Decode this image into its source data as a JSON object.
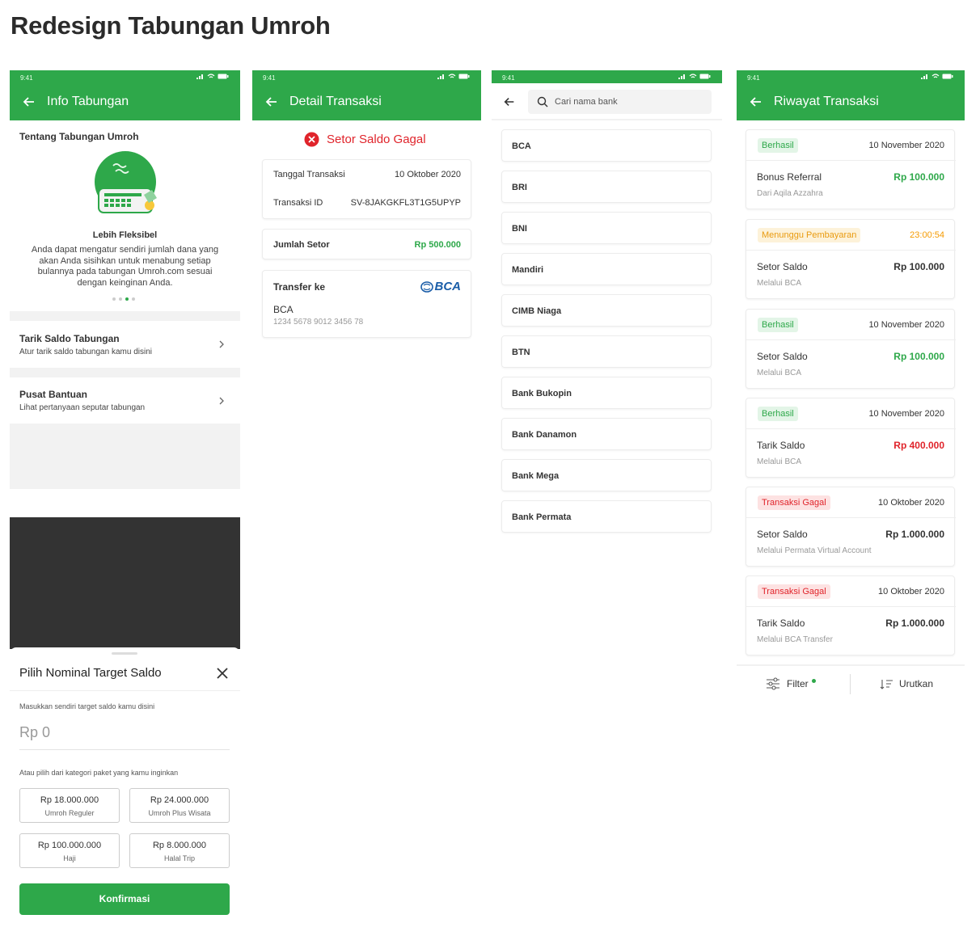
{
  "page_title": "Redesign Tabungan Umroh",
  "status_time": "9:41",
  "screen1": {
    "title": "Info Tabungan",
    "section_title": "Tentang Tabungan Umroh",
    "feature_title": "Lebih Fleksibel",
    "feature_desc": "Anda dapat mengatur sendiri jumlah dana yang akan Anda sisihkan untuk menabung setiap bulannya pada tabungan Umroh.com sesuai dengan keinginan Anda.",
    "menu": [
      {
        "title": "Tarik Saldo Tabungan",
        "subtitle": "Atur tarik saldo tabungan kamu disini"
      },
      {
        "title": "Pusat Bantuan",
        "subtitle": "Lihat pertanyaan seputar tabungan"
      }
    ]
  },
  "sheet": {
    "title": "Pilih Nominal Target Saldo",
    "input_label": "Masukkan sendiri target saldo kamu disini",
    "input_value": "Rp 0",
    "category_label": "Atau pilih dari kategori paket yang kamu inginkan",
    "packages": [
      {
        "price": "Rp 18.000.000",
        "name": "Umroh Reguler"
      },
      {
        "price": "Rp 24.000.000",
        "name": "Umroh Plus Wisata"
      },
      {
        "price": "Rp 100.000.000",
        "name": "Haji"
      },
      {
        "price": "Rp 8.000.000",
        "name": "Halal Trip"
      }
    ],
    "confirm_label": "Konfirmasi"
  },
  "screen2": {
    "title": "Detail Transaksi",
    "status": "Setor Saldo Gagal",
    "date_label": "Tanggal Transaksi",
    "date_value": "10 Oktober 2020",
    "id_label": "Transaksi ID",
    "id_value": "SV-8JAKGKFL3T1G5UPYP",
    "amount_label": "Jumlah Setor",
    "amount_value": "Rp 500.000",
    "transfer_label": "Transfer ke",
    "bank_logo": "BCA",
    "bank_name": "BCA",
    "account_number": "1234 5678 9012 3456 78"
  },
  "screen3": {
    "search_placeholder": "Cari nama bank",
    "banks": [
      "BCA",
      "BRI",
      "BNI",
      "Mandiri",
      "CIMB Niaga",
      "BTN",
      "Bank Bukopin",
      "Bank Danamon",
      "Bank Mega",
      "Bank Permata"
    ]
  },
  "screen4": {
    "title": "Riwayat Transaksi",
    "transactions": [
      {
        "status": "Berhasil",
        "status_type": "ok",
        "date": "10 November 2020",
        "title": "Bonus Referral",
        "amount": "Rp 100.000",
        "amount_color": "#2ea84a",
        "sub": "Dari Aqila Azzahra"
      },
      {
        "status": "Menunggu Pembayaran",
        "status_type": "wait",
        "date": "23:00:54",
        "title": "Setor Saldo",
        "amount": "Rp 100.000",
        "amount_color": "#333333",
        "sub": "Melalui BCA"
      },
      {
        "status": "Berhasil",
        "status_type": "ok",
        "date": "10 November 2020",
        "title": "Setor Saldo",
        "amount": "Rp 100.000",
        "amount_color": "#2ea84a",
        "sub": "Melalui BCA"
      },
      {
        "status": "Berhasil",
        "status_type": "ok",
        "date": "10 November 2020",
        "title": "Tarik Saldo",
        "amount": "Rp 400.000",
        "amount_color": "#e0242b",
        "sub": "Melalui BCA"
      },
      {
        "status": "Transaksi Gagal",
        "status_type": "fail",
        "date": "10 Oktober 2020",
        "title": "Setor Saldo",
        "amount": "Rp 1.000.000",
        "amount_color": "#333333",
        "sub": "Melalui Permata Virtual Account"
      },
      {
        "status": "Transaksi Gagal",
        "status_type": "fail",
        "date": "10 Oktober 2020",
        "title": "Tarik Saldo",
        "amount": "Rp 1.000.000",
        "amount_color": "#333333",
        "sub": "Melalui BCA Transfer"
      }
    ],
    "filter_label": "Filter",
    "sort_label": "Urutkan"
  },
  "colors": {
    "primary": "#2ea84a",
    "danger": "#e0242b",
    "warning": "#f59a00"
  }
}
